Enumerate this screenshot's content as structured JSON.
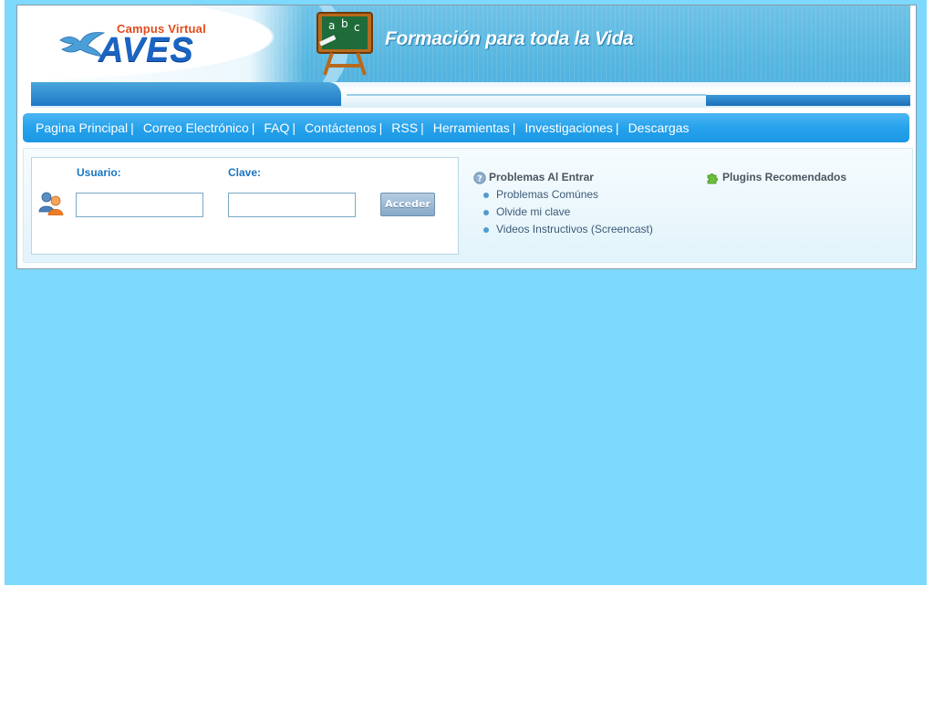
{
  "header": {
    "logo_top": "Campus Virtual",
    "logo_main": "AVES",
    "tagline": "Formación para toda la Vida",
    "chalkboard_text": "a b c"
  },
  "nav": {
    "items": [
      {
        "label": "Pagina Principal",
        "sep": "|"
      },
      {
        "label": "Correo Electrónico",
        "sep": "|"
      },
      {
        "label": "FAQ",
        "sep": "|"
      },
      {
        "label": "Contáctenos",
        "sep": "|"
      },
      {
        "label": "RSS",
        "sep": "|"
      },
      {
        "label": "Herramientas",
        "sep": "|"
      },
      {
        "label": "Investigaciones",
        "sep": "|"
      },
      {
        "label": "Descargas",
        "sep": ""
      }
    ]
  },
  "login": {
    "user_label": "Usuario:",
    "user_value": "",
    "pass_label": "Clave:",
    "pass_value": "",
    "submit_label": "Acceder"
  },
  "help": {
    "title": "Problemas Al Entrar",
    "links": [
      "Problemas Comúnes",
      "Olvide mi clave",
      "Videos Instructivos (Screencast)"
    ]
  },
  "plugins": {
    "title": "Plugins Recomendados"
  },
  "colors": {
    "page_background": "#7dd9fd",
    "nav_blue": "#26a2ec",
    "label_blue": "#1a75bf",
    "logo_blue": "#1a64c4",
    "logo_orange": "#e24a1c"
  },
  "icons": {
    "users": "users-icon",
    "help": "help-icon",
    "plugin": "puzzle-icon",
    "bird": "dove-logo-icon",
    "chalkboard": "chalkboard-icon"
  }
}
